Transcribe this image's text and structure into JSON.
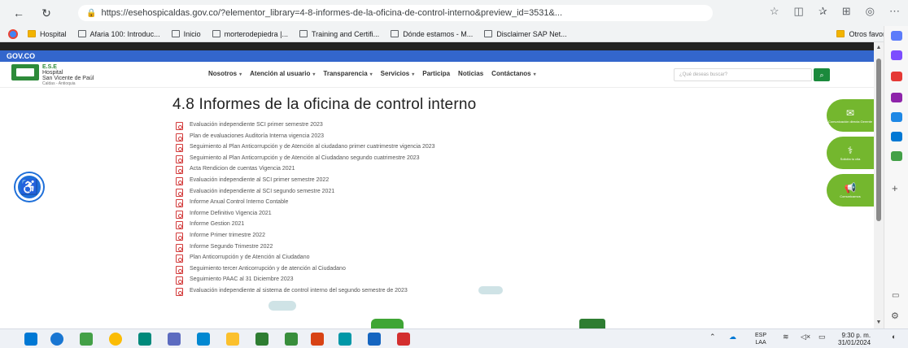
{
  "browser": {
    "url": "https://esehospicaldas.gov.co/?elementor_library=4-8-informes-de-la-oficina-de-control-interno&preview_id=3531&...",
    "bookmarks": [
      "Hospital",
      "Afaria 100: Introduc...",
      "Inicio",
      "morterodepiedra |...",
      "Training and Certifi...",
      "Dónde estamos - M...",
      "Disclaimer SAP Net..."
    ],
    "other_favorites": "Otros favoritos"
  },
  "gov_bar": "GOV.CO",
  "logo": {
    "line1": "E.S.E",
    "line2": "Hospital",
    "line3": "San Vicente de Paúl",
    "line4": "Caldas - Antioquia"
  },
  "menu": [
    {
      "label": "Nosotros",
      "dropdown": true
    },
    {
      "label": "Atención al usuario",
      "dropdown": true
    },
    {
      "label": "Transparencia",
      "dropdown": true
    },
    {
      "label": "Servicios",
      "dropdown": true
    },
    {
      "label": "Participa",
      "dropdown": false
    },
    {
      "label": "Noticias",
      "dropdown": false
    },
    {
      "label": "Contáctanos",
      "dropdown": true
    }
  ],
  "search_placeholder": "¿Qué deseas buscar?",
  "page_title": "4.8 Informes de la oficina de control interno",
  "documents": [
    "Evaluación independiente SCI primer semestre 2023",
    "Plan de evaluaciones Auditoría Interna vigencia 2023",
    "Seguimiento al Plan Anticorrupción y de Atención al ciudadano primer cuatrimestre vigencia 2023",
    "Seguimiento al Plan Anticorrupción y de Atención al Ciudadano segundo cuatrimestre 2023",
    "Acta Rendicion de cuentas Vigencia 2021",
    "Evaluación independiente al SCI primer semestre 2022",
    "Evaluación independiente al SCI segundo semestre 2021",
    "Informe Anual Control Interno Contable",
    "Informe Definitivo Vigencia 2021",
    "Informe Gestion 2021",
    "Informe Primer trimestre 2022",
    "Informe Segundo Trimestre 2022",
    "Plan Anticorrupción y de Atención al Ciudadano",
    "Seguimiento tercer Anticorrupción y de atención al Ciudadano",
    "Seguimiento PAAC al 31 Diciembre 2023",
    "Evaluación independiente al sistema de control interno del segundo semestre de 2023"
  ],
  "side_buttons": [
    {
      "label": "Comunicación directa Gerente",
      "icon": "chat-icon"
    },
    {
      "label": "Solicita tu cita",
      "icon": "stethoscope-icon"
    },
    {
      "label": "Comunicamos",
      "icon": "megaphone-icon"
    }
  ],
  "taskbar": {
    "lang1": "ESP",
    "lang2": "LAA",
    "time": "9:30 p. m.",
    "date": "31/01/2024"
  },
  "colors": {
    "gov_blue": "#3366cc",
    "green": "#74b72e",
    "pdf_red": "#d33b3b",
    "access_blue": "#1e6fd9"
  }
}
